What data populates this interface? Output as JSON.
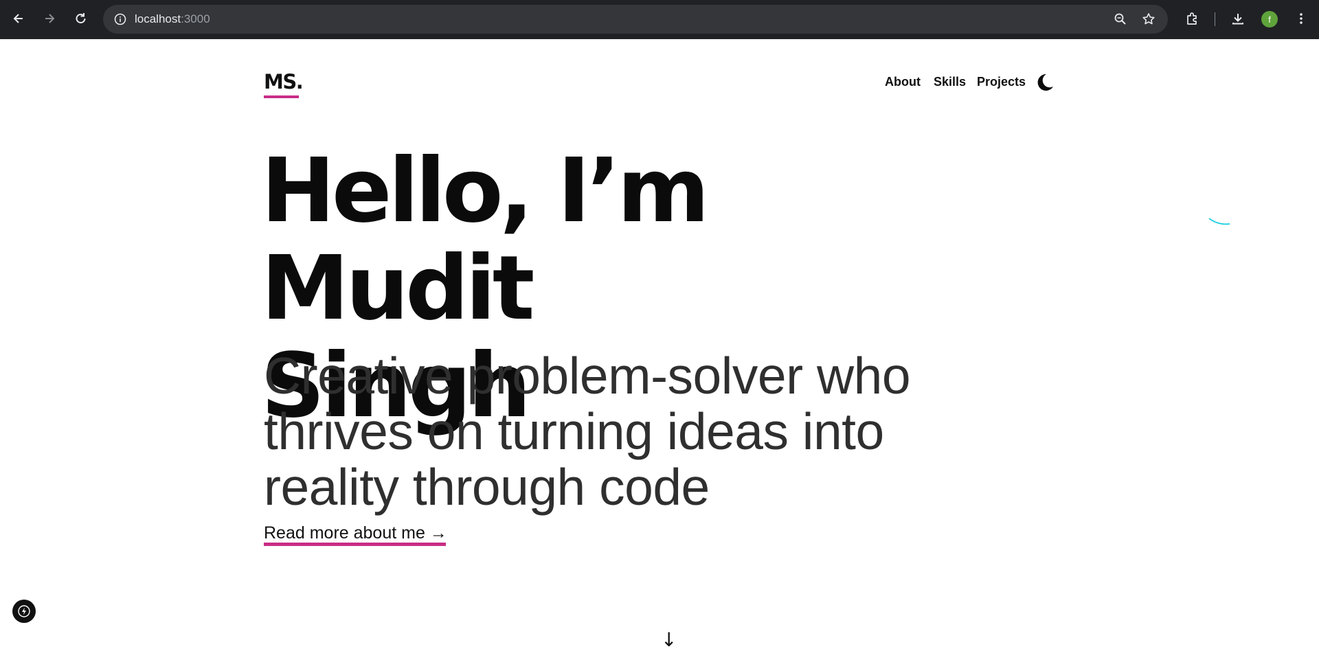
{
  "browser": {
    "url_host": "localhost",
    "url_port": ":3000",
    "profile_initial": "f"
  },
  "site": {
    "logo": "MS.",
    "nav": [
      "About",
      "Skills",
      "Projects"
    ],
    "accent_color": "#c92d86"
  },
  "hero": {
    "title_line1": "Hello, I’m Mudit",
    "title_line2": "Singh",
    "tagline_line1": "Creative problem-solver who",
    "tagline_line2": "thrives on turning ideas into",
    "tagline_line3": "reality through code",
    "cta": "Read more about me →"
  },
  "scroll_indicator": "↓"
}
